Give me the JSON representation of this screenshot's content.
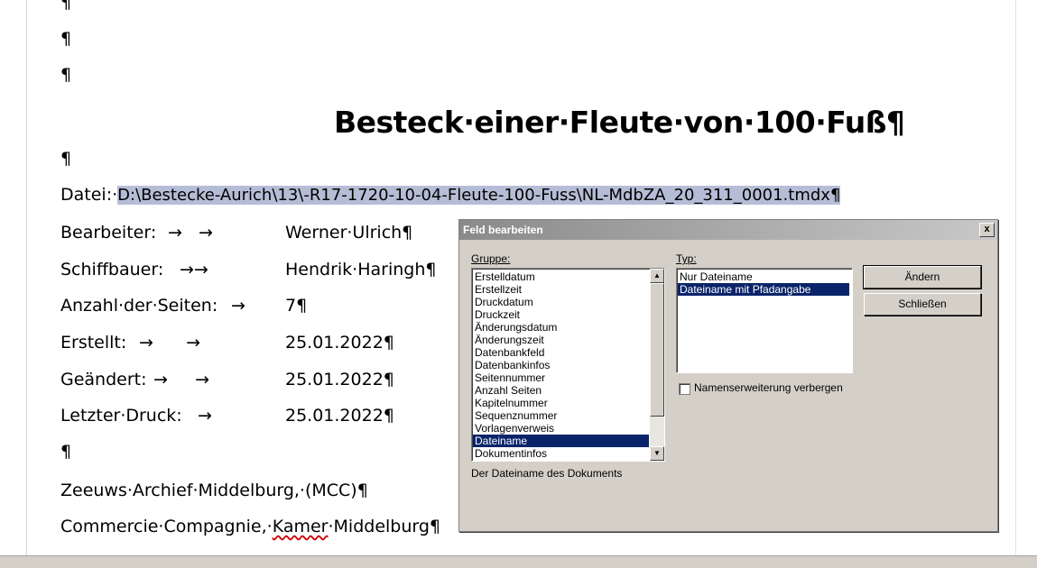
{
  "document": {
    "pilcrow": "¶",
    "top_pilcrows": [
      "¶",
      "¶",
      "¶"
    ],
    "title": "Besteck·einer·Fleute·von·100·Fuß¶",
    "blank_after_title": "¶",
    "datei_label": "Datei:·",
    "datei_value": "D:\\Bestecke-Aurich\\13\\-R17-1720-10-04-Fleute-100-Fuss\\NL-MdbZA_20_311_0001.tmdx¶",
    "fields": [
      {
        "label": "Bearbeiter:",
        "arrows": "→   →",
        "value": "Werner·Ulrich¶"
      },
      {
        "label": "Schiffbauer:",
        "arrows": "→→",
        "value": "Hendrik·Haringh¶"
      },
      {
        "label": "Anzahl·der·Seiten:",
        "arrows": "→",
        "value": "7¶"
      },
      {
        "label": "Erstellt:",
        "arrows": "→      →",
        "value": "25.01.2022¶"
      },
      {
        "label": "Geändert:",
        "arrows": "→     →",
        "value": "25.01.2022¶"
      },
      {
        "label": "Letzter·Druck:",
        "arrows": "→",
        "value": "25.01.2022¶"
      }
    ],
    "blank_after_fields": "¶",
    "footer_line1": "Zeeuws·Archief·Middelburg,·(MCC)¶",
    "footer_line2_a": "Commercie·Compagnie,·",
    "footer_line2_b": "Kamer",
    "footer_line2_c": "·Middelburg¶"
  },
  "dialog": {
    "title": "Feld bearbeiten",
    "close_label": "x",
    "gruppe_label": "Gruppe:",
    "typ_label": "Typ:",
    "gruppe_items": [
      "Erstelldatum",
      "Erstellzeit",
      "Druckdatum",
      "Druckzeit",
      "Änderungsdatum",
      "Änderungszeit",
      "Datenbankfeld",
      "Datenbankinfos",
      "Seitennummer",
      "Anzahl Seiten",
      "Kapitelnummer",
      "Sequenznummer",
      "Vorlagenverweis",
      "Dateiname",
      "Dokumentinfos"
    ],
    "gruppe_selected": "Dateiname",
    "typ_items": [
      "Nur Dateiname",
      "Dateiname mit Pfadangabe"
    ],
    "typ_selected": "Dateiname mit Pfadangabe",
    "aendern_label": "Ändern",
    "schliessen_label": "Schließen",
    "checkbox_label": "Namenserweiterung verbergen",
    "checkbox_checked": false,
    "description": "Der Dateiname des Dokuments"
  },
  "colors": {
    "selection_highlight": "#b5bdd6",
    "list_selected": "#0a246a",
    "dialog_bg": "#d4d0c8"
  }
}
